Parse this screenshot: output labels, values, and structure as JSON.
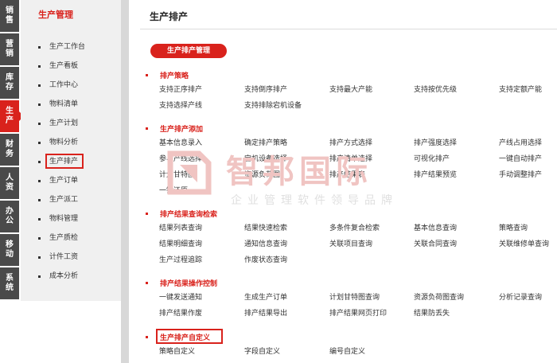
{
  "nav_tabs": [
    {
      "label": "销售",
      "active": false
    },
    {
      "label": "营销",
      "active": false
    },
    {
      "label": "库存",
      "active": false
    },
    {
      "label": "生产",
      "active": true
    },
    {
      "label": "财务",
      "active": false
    },
    {
      "label": "人资",
      "active": false
    },
    {
      "label": "办公",
      "active": false
    },
    {
      "label": "移动",
      "active": false
    },
    {
      "label": "系统",
      "active": false
    }
  ],
  "sidebar": {
    "title": "生产管理",
    "items": [
      {
        "label": "生产工作台"
      },
      {
        "label": "生产看板"
      },
      {
        "label": "工作中心"
      },
      {
        "label": "物料清单"
      },
      {
        "label": "生产计划"
      },
      {
        "label": "物料分析"
      },
      {
        "label": "生产排产",
        "selected": true
      },
      {
        "label": "生产订单"
      },
      {
        "label": "生产派工"
      },
      {
        "label": "物料管理"
      },
      {
        "label": "生产质检"
      },
      {
        "label": "计件工资"
      },
      {
        "label": "成本分析"
      }
    ]
  },
  "main": {
    "title": "生产排产",
    "pill": "生产排产管理",
    "sections": [
      {
        "title": "排产策略",
        "highlighted": false,
        "rows": [
          [
            "支持正序排产",
            "支持倒序排产",
            "支持最大产能",
            "支持按优先级",
            "支持定额产能"
          ],
          [
            "支持选择产线",
            "支持排除宕机设备"
          ]
        ]
      },
      {
        "title": "生产排产添加",
        "highlighted": false,
        "rows": [
          [
            "基本信息录入",
            "确定排产策略",
            "排产方式选择",
            "排产强度选择",
            "产线占用选择"
          ],
          [
            "参与产线选择",
            "宕机设备选择",
            "排产清单选择",
            "可视化排产",
            "一键自动排产"
          ],
          [
            "计划甘特图",
            "资源负荷图",
            "排产结果表",
            "排产结果预览",
            "手动调整排产"
          ],
          [
            "一键还原"
          ]
        ]
      },
      {
        "title": "排产结果查询检索",
        "highlighted": false,
        "rows": [
          [
            "结果列表查询",
            "结果快速检索",
            "多条件复合检索",
            "基本信息查询",
            "策略查询"
          ],
          [
            "结果明细查询",
            "通知信息查询",
            "关联项目查询",
            "关联合同查询",
            "关联维修单查询"
          ],
          [
            "生产过程追踪",
            "作废状态查询"
          ]
        ]
      },
      {
        "title": "排产结果操作控制",
        "highlighted": false,
        "rows": [
          [
            "一键发送通知",
            "生成生产订单",
            "计划甘特图查询",
            "资源负荷图查询",
            "分析记录查询"
          ],
          [
            "排产结果作废",
            "排产结果导出",
            "排产结果网页打印",
            "结果防丢失"
          ]
        ]
      },
      {
        "title": "生产排产自定义",
        "highlighted": true,
        "rows": [
          [
            "策略自定义",
            "字段自定义",
            "编号自定义"
          ]
        ]
      }
    ]
  },
  "watermark": {
    "brand": "智邦国际",
    "slogan": "企业管理软件领导品牌",
    "color": "#d9221c"
  },
  "colors": {
    "accent": "#d9221c",
    "tab_bg": "#4a4a4a",
    "sidebar_bg": "#f0f0f0"
  }
}
